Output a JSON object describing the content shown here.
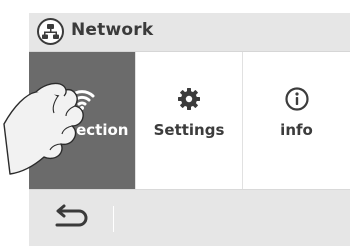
{
  "titlebar": {
    "title": "Network",
    "icon": "network-icon"
  },
  "menu": {
    "items": [
      {
        "label": "connection",
        "icon": "wifi-icon",
        "active": true
      },
      {
        "label": "Settings",
        "icon": "gear-icon",
        "active": false
      },
      {
        "label": "info",
        "icon": "info-icon",
        "active": false
      }
    ]
  },
  "bottombar": {
    "back_icon": "back-arrow-icon"
  },
  "colors": {
    "titlebar_bg": "#e6e6e6",
    "active_bg": "#6b6b6b",
    "text": "#3c3c3c"
  }
}
